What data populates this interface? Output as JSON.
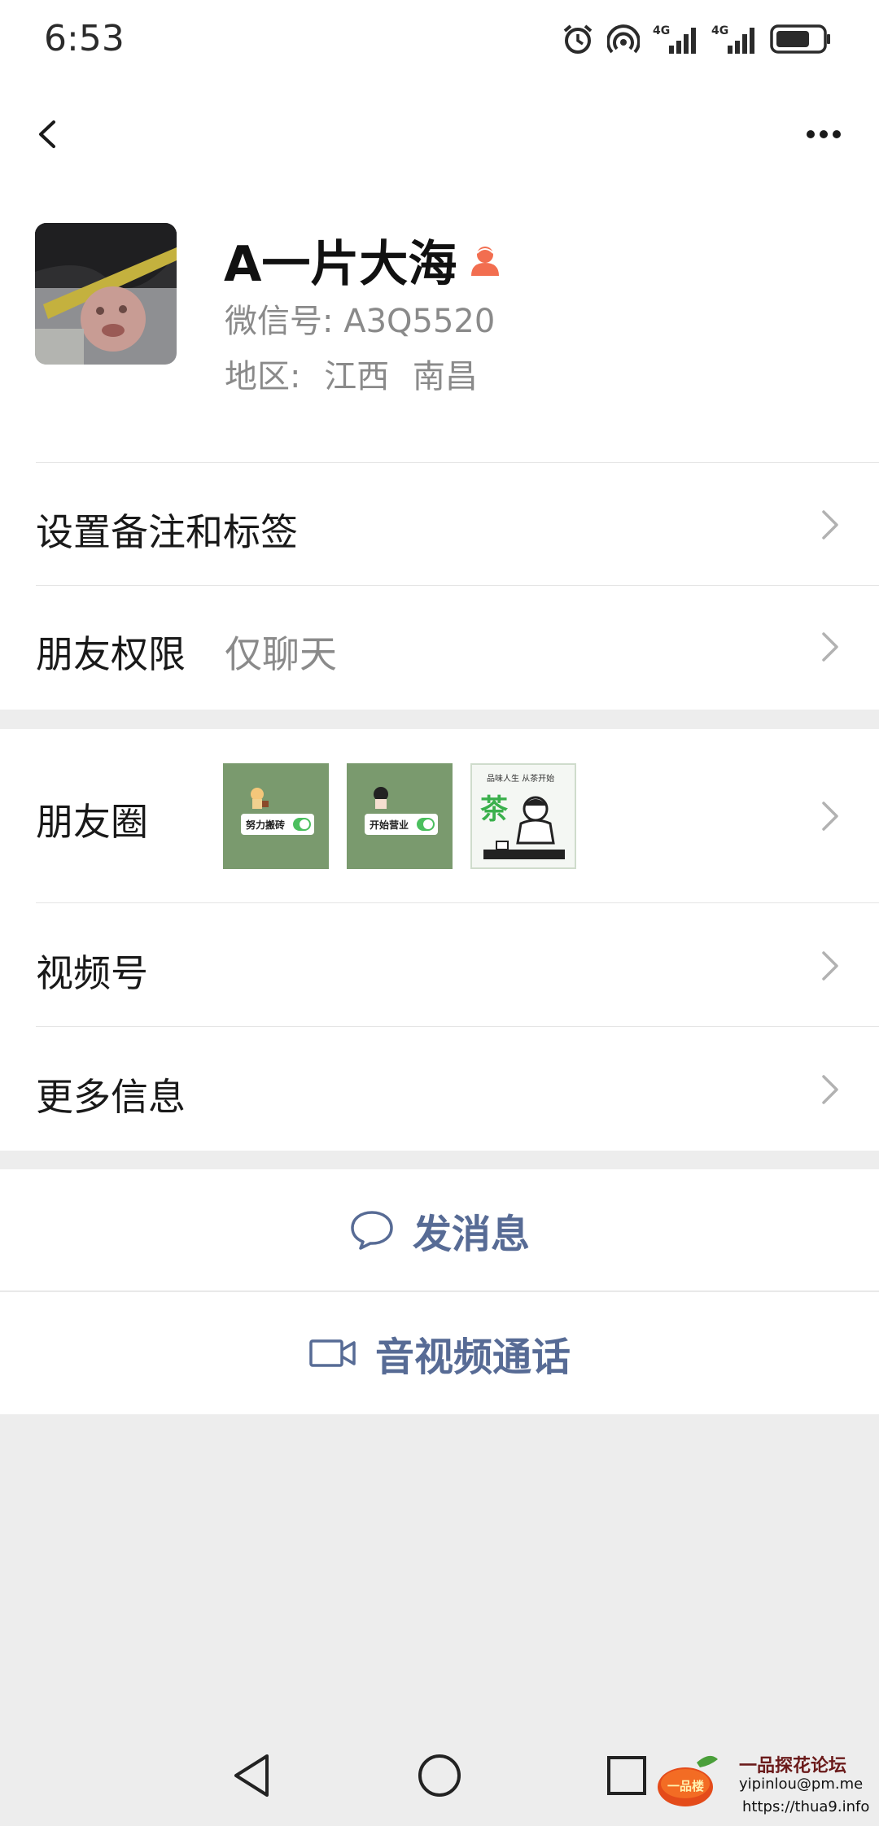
{
  "status_bar": {
    "time": "6:53",
    "icons": [
      "alarm-icon",
      "hotspot-icon",
      "signal-4g-icon",
      "signal-4g-icon",
      "battery-icon"
    ],
    "network_1": "4G",
    "network_2": "4G"
  },
  "nav": {
    "back_icon": "chevron-left-icon",
    "more_icon": "more-horizontal-icon"
  },
  "profile": {
    "nickname": "A一片大海",
    "gender_icon": "female-icon",
    "gender_color": "#f26e50",
    "wechat_id_label": "微信号:",
    "wechat_id": "A3Q5520",
    "region_label": "地区:",
    "region_province": "江西",
    "region_city": "南昌"
  },
  "cells": {
    "remarks_tags": {
      "label": "设置备注和标签"
    },
    "friend_permission": {
      "label": "朋友权限",
      "value": "仅聊天"
    },
    "moments": {
      "label": "朋友圈",
      "thumbnails": [
        {
          "caption": "努力搬砖"
        },
        {
          "caption": "开始营业"
        },
        {
          "caption_top": "品味人生 从茶开始",
          "caption_big": "茶"
        }
      ]
    },
    "channels": {
      "label": "视频号"
    },
    "more_info": {
      "label": "更多信息"
    }
  },
  "actions": {
    "send_message": {
      "label": "发消息",
      "icon": "chat-bubble-icon"
    },
    "av_call": {
      "label": "音视频通话",
      "icon": "video-camera-icon"
    }
  },
  "system_nav": {
    "back": "triangle-back-icon",
    "home": "circle-home-icon",
    "recents": "square-recents-icon"
  },
  "watermark": {
    "logo_text": "一品楼",
    "title": "一品探花论坛",
    "email": "yipinlou@pm.me",
    "url": "https://thua9.info"
  },
  "colors": {
    "link_blue": "#576b95",
    "chevron": "#b2b2b2",
    "secondary_text": "#8a8a8a",
    "background": "#ededed"
  }
}
